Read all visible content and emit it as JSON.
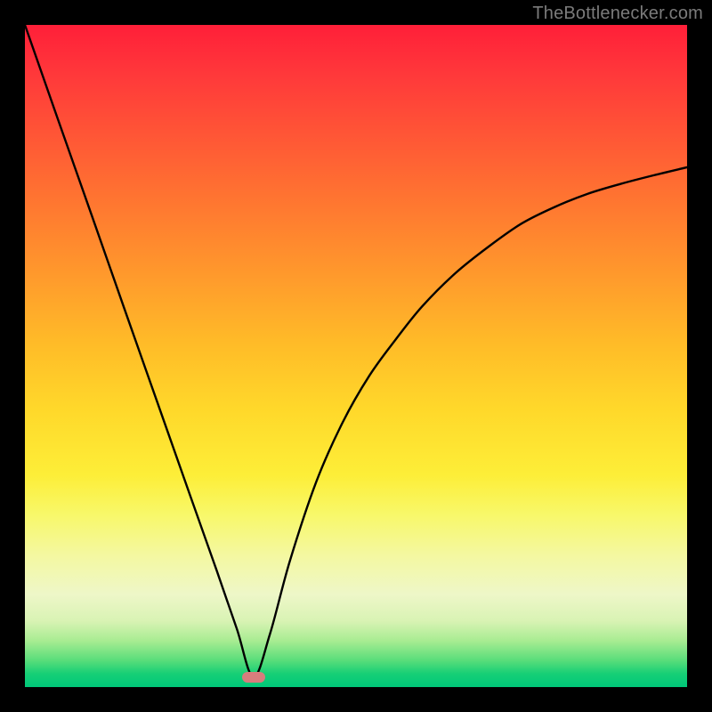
{
  "watermark": "TheBottlenecker.com",
  "chart_data": {
    "type": "line",
    "title": "",
    "xlabel": "",
    "ylabel": "",
    "xlim": [
      0,
      1
    ],
    "ylim": [
      0,
      1
    ],
    "x_min_point": 0.345,
    "series": [
      {
        "name": "bottleneck-curve",
        "x": [
          0.0,
          0.05,
          0.1,
          0.15,
          0.2,
          0.25,
          0.29,
          0.32,
          0.345,
          0.37,
          0.4,
          0.44,
          0.48,
          0.52,
          0.56,
          0.6,
          0.65,
          0.7,
          0.75,
          0.8,
          0.85,
          0.9,
          0.95,
          1.0
        ],
        "y": [
          1.0,
          0.857,
          0.715,
          0.572,
          0.43,
          0.288,
          0.175,
          0.088,
          0.015,
          0.08,
          0.19,
          0.31,
          0.4,
          0.47,
          0.525,
          0.575,
          0.625,
          0.665,
          0.7,
          0.725,
          0.745,
          0.76,
          0.773,
          0.785
        ]
      }
    ],
    "marker": {
      "x": 0.345,
      "y": 0.015,
      "color": "#d77d7d"
    },
    "background_gradient": {
      "top": "#ff1f39",
      "mid": "#ffd82a",
      "bottom": "#00c779"
    }
  }
}
